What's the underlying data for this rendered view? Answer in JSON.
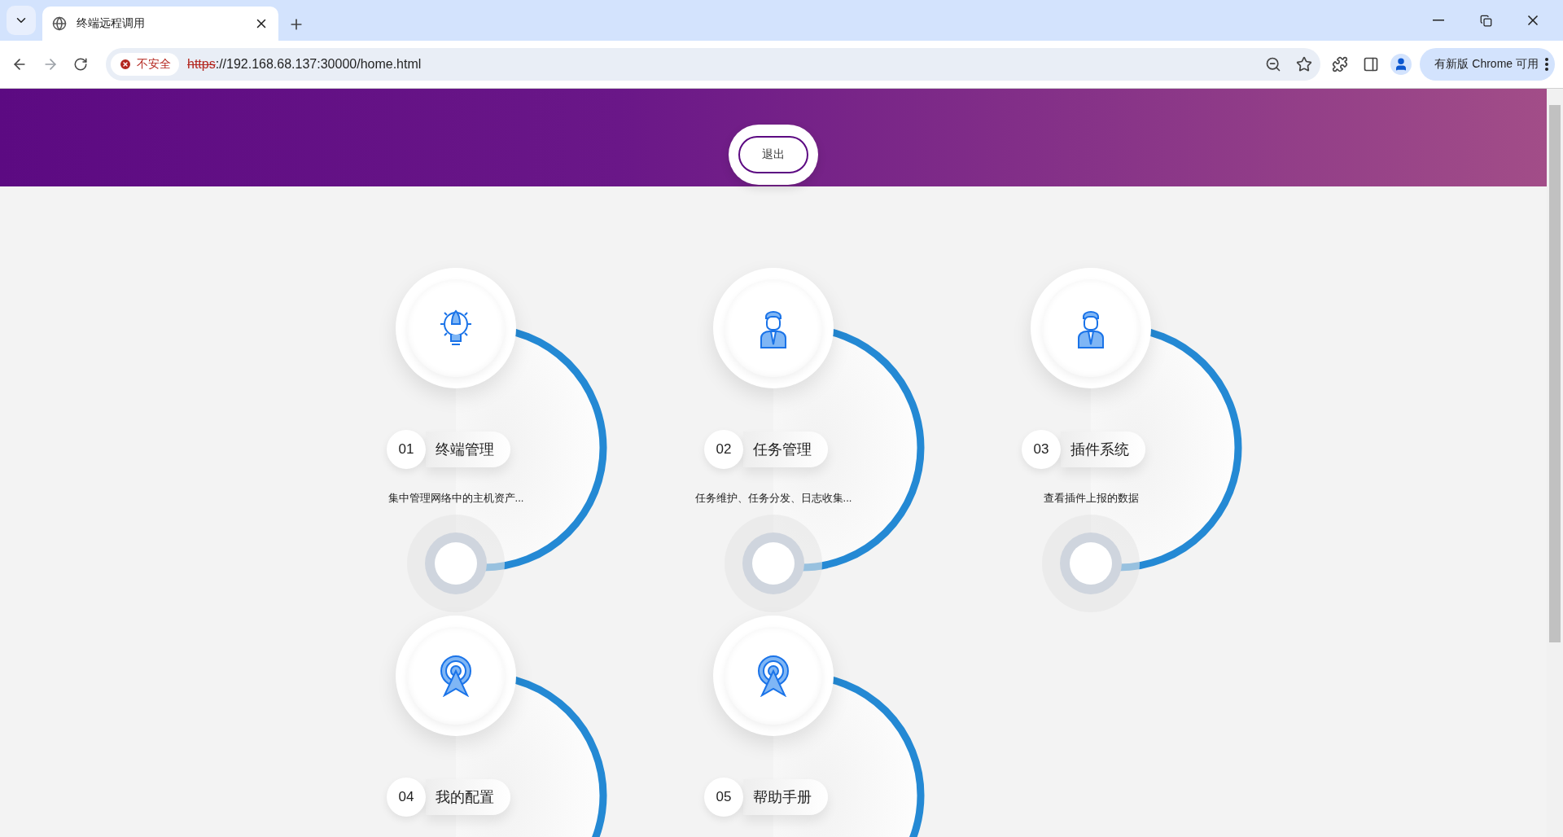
{
  "browser": {
    "tab_title": "终端远程调用",
    "security_label": "不安全",
    "url_scheme": "https",
    "url_rest": "://192.168.68.137:30000/home.html",
    "update_button": "有新版 Chrome 可用"
  },
  "header": {
    "logout_button": "退出"
  },
  "cards": [
    {
      "number": "01",
      "title": "终端管理",
      "description": "集中管理网络中的主机资产...",
      "kind": "bulb"
    },
    {
      "number": "02",
      "title": "任务管理",
      "description": "任务维护、任务分发、日志收集...",
      "kind": "person"
    },
    {
      "number": "03",
      "title": "插件系统",
      "description": "查看插件上报的数据",
      "kind": "person"
    },
    {
      "number": "04",
      "title": "我的配置",
      "kind": "antenna"
    },
    {
      "number": "05",
      "title": "帮助手册",
      "kind": "antenna"
    }
  ]
}
